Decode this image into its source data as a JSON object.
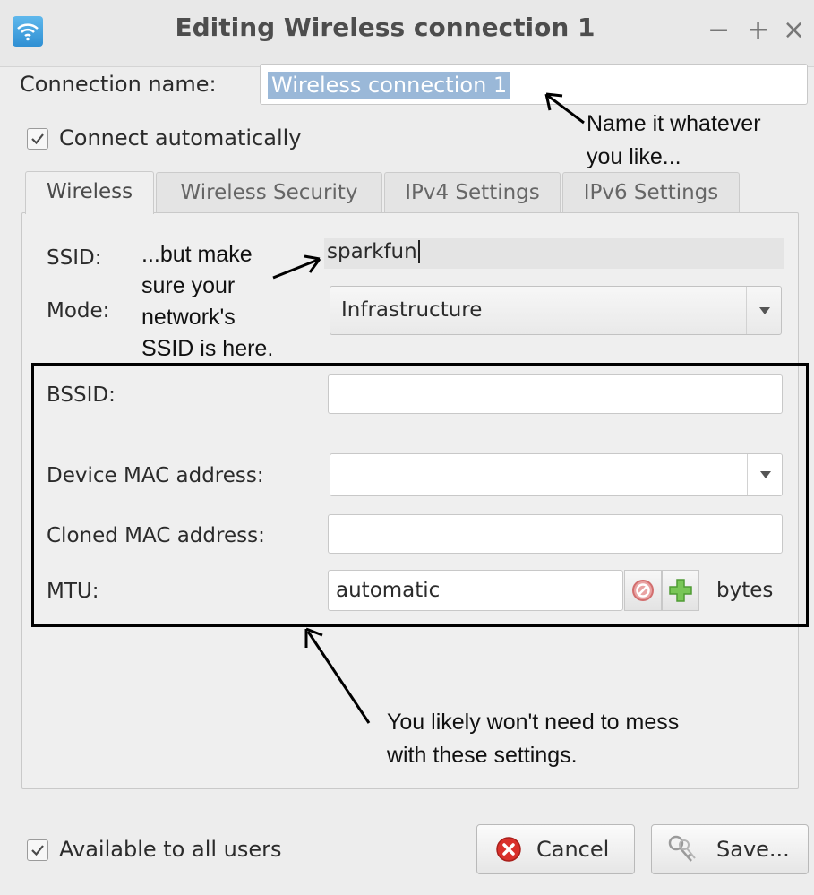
{
  "window": {
    "title": "Editing Wireless connection 1",
    "controls": [
      "−",
      "+",
      "×"
    ]
  },
  "connection": {
    "label": "Connection name:",
    "value": "Wireless connection 1",
    "connect_auto_label": "Connect automatically",
    "connect_auto_checked": true
  },
  "tabs": [
    {
      "label": "Wireless",
      "active": true
    },
    {
      "label": "Wireless Security",
      "active": false
    },
    {
      "label": "IPv4 Settings",
      "active": false
    },
    {
      "label": "IPv6 Settings",
      "active": false
    }
  ],
  "wireless": {
    "ssid_label": "SSID:",
    "ssid_value": "sparkfun",
    "mode_label": "Mode:",
    "mode_value": "Infrastructure",
    "bssid_label": "BSSID:",
    "bssid_value": "",
    "device_mac_label": "Device MAC address:",
    "device_mac_value": "",
    "cloned_mac_label": "Cloned MAC address:",
    "cloned_mac_value": "",
    "mtu_label": "MTU:",
    "mtu_value": "automatic",
    "mtu_unit": "bytes"
  },
  "annotations": {
    "name_note_1": "Name it whatever",
    "name_note_2": "you like...",
    "ssid_note_1": "...but make",
    "ssid_note_2": "sure your",
    "ssid_note_3": "network's",
    "ssid_note_4": "SSID is here.",
    "settings_note_1": "You likely won't need to mess",
    "settings_note_2": "with these settings."
  },
  "footer": {
    "all_users_label": "Available to all users",
    "all_users_checked": true,
    "cancel_label": "Cancel",
    "save_label": "Save..."
  },
  "icons": {
    "window": "wifi-icon",
    "cancel": "cancel-icon",
    "save": "keys-icon",
    "mtu_clear": "clear-icon",
    "mtu_add": "plus-icon"
  },
  "colors": {
    "selection": "#9ab8d8",
    "cancel_red": "#d9302b",
    "plus_green": "#6cc04a"
  }
}
